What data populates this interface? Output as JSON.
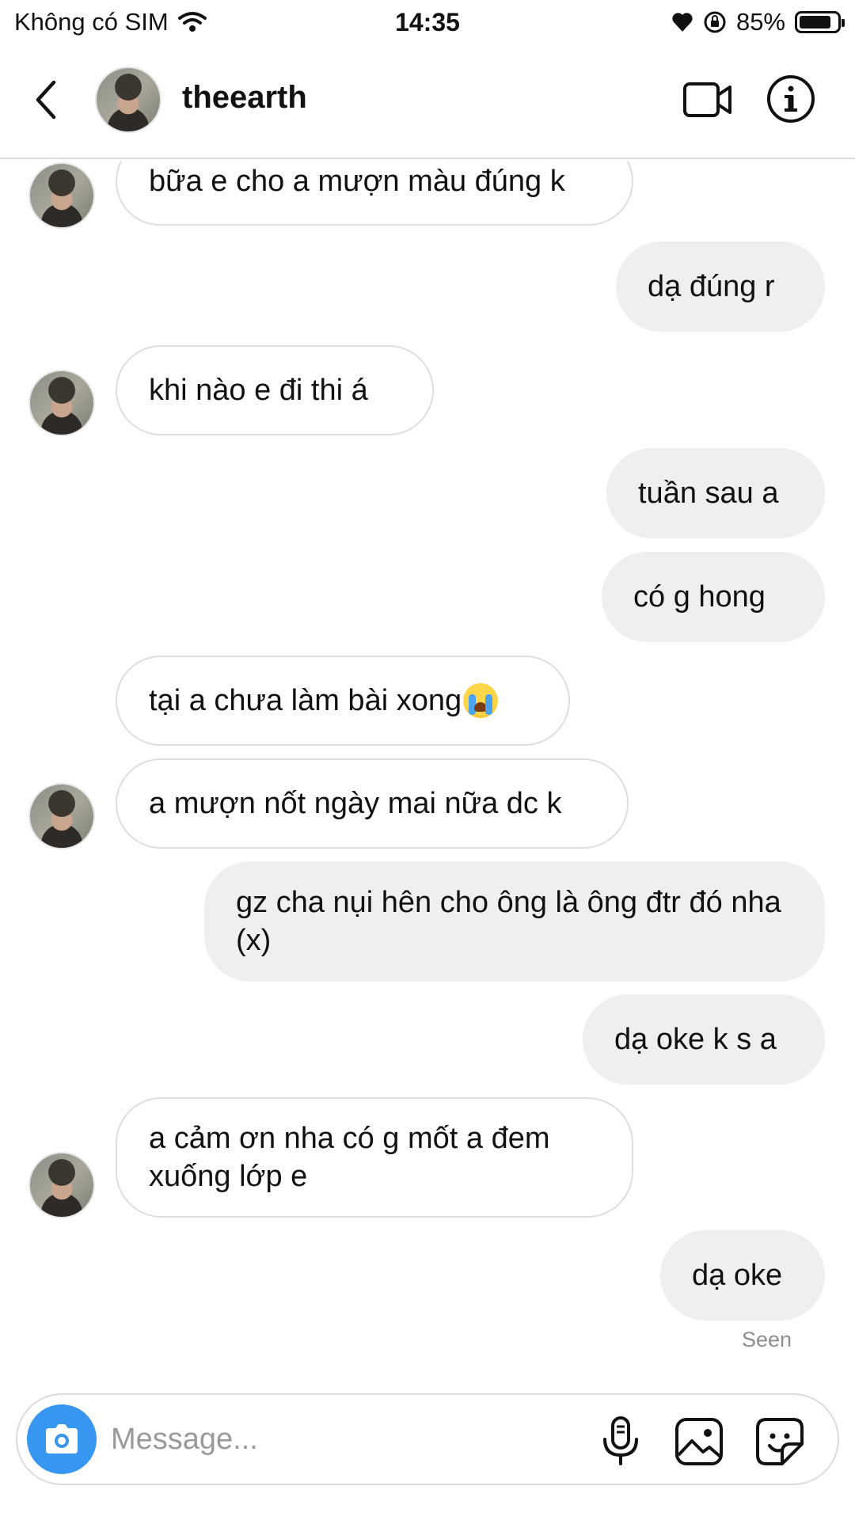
{
  "status_bar": {
    "carrier": "Không có SIM",
    "time": "14:35",
    "battery": "85%",
    "battery_level": 0.85
  },
  "header": {
    "username": "theearth",
    "icons": [
      "back-chevron-icon",
      "video-call-icon",
      "info-icon"
    ]
  },
  "messages": [
    {
      "from": "them",
      "text": "bữa e cho a mượn màu đúng k"
    },
    {
      "from": "me",
      "text": "dạ đúng r"
    },
    {
      "from": "them",
      "text": "khi nào e đi thi á"
    },
    {
      "from": "me",
      "text": "tuần sau a"
    },
    {
      "from": "me",
      "text": "có g hong"
    },
    {
      "from": "them",
      "text": "tại a chưa làm bài xong",
      "emoji": "crying-face"
    },
    {
      "from": "them",
      "text": "a mượn nốt ngày mai nữa dc k"
    },
    {
      "from": "me",
      "text": "gz cha nụi hên cho ông là ông đtr đó nha (x)"
    },
    {
      "from": "me",
      "text": "dạ oke k s a"
    },
    {
      "from": "them",
      "text": "a cảm ơn nha có g mốt a đem xuống lớp e"
    },
    {
      "from": "me",
      "text": "dạ oke"
    }
  ],
  "seen_label": "Seen",
  "composer": {
    "placeholder": "Message...",
    "value": "",
    "icons": [
      "camera-icon",
      "microphone-icon",
      "gallery-icon",
      "sticker-icon"
    ]
  },
  "colors": {
    "accent": "#3797f0",
    "outgoing_bubble": "#efefef",
    "incoming_border": "#dedede"
  }
}
